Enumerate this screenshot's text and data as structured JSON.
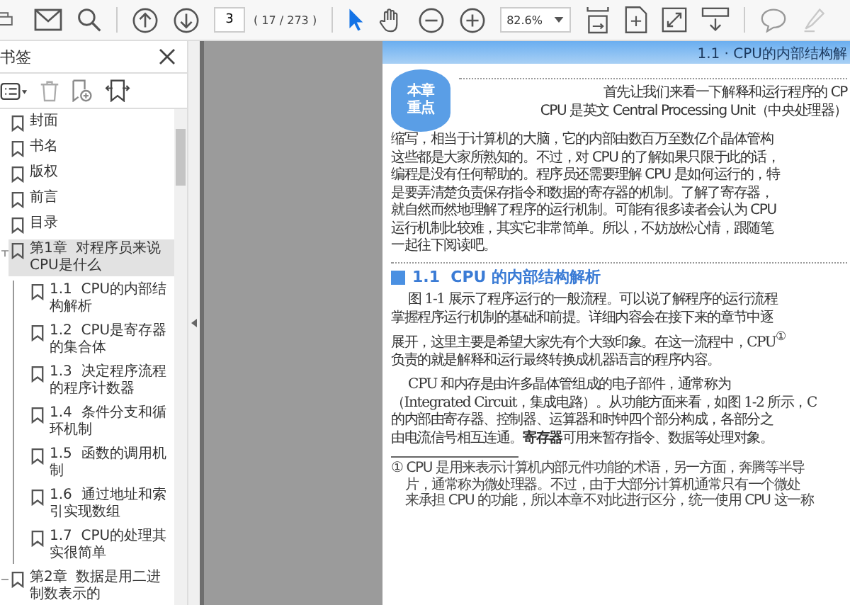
{
  "toolbar": {
    "tools": [
      {
        "kind": "select",
        "selected": true
      },
      {
        "kind": "hand",
        "selected": false
      }
    ],
    "page_field": {
      "value": "3"
    },
    "page_count": "( 17 / 273 )",
    "zoom": {
      "value": "82.6%"
    },
    "highlighter": {
      "disabled": true
    }
  },
  "bookmarks_panel": {
    "title": "书签",
    "items": [
      {
        "label": "封面",
        "selected": false
      },
      {
        "label": "书名",
        "selected": false
      },
      {
        "label": "版权",
        "selected": false
      },
      {
        "label": "前言",
        "selected": false
      },
      {
        "label": "目录",
        "selected": false
      },
      {
        "label": "第1章  对程序员来说CPU是什么",
        "selected": true,
        "expanded": true,
        "children": [
          {
            "label": "1.1  CPU的内部结构解析",
            "selected": false
          },
          {
            "label": "1.2  CPU是寄存器的集合体",
            "selected": false
          },
          {
            "label": "1.3  决定程序流程的程序计数器",
            "selected": false
          },
          {
            "label": "1.4  条件分支和循环机制",
            "selected": false
          },
          {
            "label": "1.5  函数的调用机制",
            "selected": false
          },
          {
            "label": "1.6  通过地址和索引实现数组",
            "selected": false
          },
          {
            "label": "1.7  CPU的处理其实很简单",
            "selected": false
          }
        ]
      },
      {
        "label": "第2章  数据是用二进制数表示的",
        "selected": false,
        "expanded": false
      }
    ]
  },
  "document_page": {
    "running_header": "1.1 · CPU的内部结构解",
    "badge": [
      "本章",
      "重点"
    ],
    "intro_lines": [
      "首先让我们来看一下解释和运行程序的 CP",
      "CPU 是英文 Central Processing Unit（中央处理器）",
      "缩写，相当于计算机的大脑，它的内部由数百万至数亿个晶体管构",
      "这些都是大家所熟知的。不过，对 CPU 的了解如果只限于此的话，",
      "编程是没有任何帮助的。程序员还需要理解 CPU 是如何运行的，特",
      "是要弄清楚负责保存指令和数据的寄存器的机制。了解了寄存器，",
      "就自然而然地理解了程序的运行机制。可能有很多读者会认为 CPU",
      "运行机制比较难，其实它非常简单。所以，不妨放松心情，跟随笔",
      "一起往下阅读吧。"
    ],
    "section_heading": {
      "number": "1.1",
      "title": "CPU 的内部结构解析"
    },
    "paragraphs": [
      [
        "图 1-1 展示了程序运行的一般流程。可以说了解程序的运行流程",
        "掌握程序运行机制的基础和前提。详细内容会在接下来的章节中逐",
        "展开，这里主要是希望大家先有个大致印象。在这一流程中，CPU$^{①}$",
        "负责的就是解释和运行最终转换成机器语言的程序内容。"
      ],
      [
        "CPU 和内存是由许多晶体管组成的电子部件，通常称为",
        "（Integrated Circuit，集成电路）。从功能方面来看，如图 1-2 所示，C",
        "的内部由寄存器、控制器、运算器和时钟四个部分构成，各部分之",
        "由电流信号相互连通。**寄存器**可用来暂存指令、数据等处理对象。"
      ]
    ],
    "footnote_lines": [
      "① CPU 是用来表示计算机内部元件功能的术语，另一方面，奔腾等半导",
      "片，通常称为微处理器。不过，由于大部分计算机通常只有一个微处",
      "来承担 CPU 的功能，所以本章不对此进行区分，统一使用 CPU 这一称"
    ]
  }
}
